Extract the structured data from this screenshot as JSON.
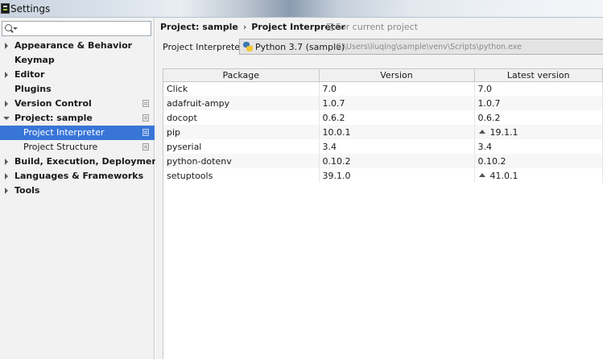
{
  "window": {
    "title": "Settings"
  },
  "search": {
    "value": "",
    "placeholder": ""
  },
  "sidebar": {
    "items": [
      {
        "label": "Appearance & Behavior",
        "expandable": true,
        "expanded": false,
        "bold": true,
        "has_project_icon": false
      },
      {
        "label": "Keymap",
        "expandable": false,
        "bold": true,
        "has_project_icon": false
      },
      {
        "label": "Editor",
        "expandable": true,
        "expanded": false,
        "bold": true,
        "has_project_icon": false
      },
      {
        "label": "Plugins",
        "expandable": false,
        "bold": true,
        "has_project_icon": false
      },
      {
        "label": "Version Control",
        "expandable": true,
        "expanded": false,
        "bold": true,
        "has_project_icon": true
      },
      {
        "label": "Project: sample",
        "expandable": true,
        "expanded": true,
        "bold": true,
        "has_project_icon": true
      },
      {
        "label": "Project Interpreter",
        "child": true,
        "selected": true,
        "has_project_icon": true
      },
      {
        "label": "Project Structure",
        "child": true,
        "selected": false,
        "has_project_icon": true
      },
      {
        "label": "Build, Execution, Deployment",
        "expandable": true,
        "expanded": false,
        "bold": true,
        "has_project_icon": false
      },
      {
        "label": "Languages & Frameworks",
        "expandable": true,
        "expanded": false,
        "bold": true,
        "has_project_icon": false
      },
      {
        "label": "Tools",
        "expandable": true,
        "expanded": false,
        "bold": true,
        "has_project_icon": false
      }
    ]
  },
  "breadcrumb": {
    "parent": "Project: sample",
    "separator": "›",
    "current": "Project Interpreter"
  },
  "for_current_project": "For current project",
  "interpreter": {
    "label": "Project Interpreter:",
    "name": "Python 3.7 (sample)",
    "path": "C:\\Users\\liuqing\\sample\\venv\\Scripts\\python.exe"
  },
  "table": {
    "headers": [
      "Package",
      "Version",
      "Latest version"
    ],
    "rows": [
      {
        "package": "Click",
        "version": "7.0",
        "latest": "7.0",
        "upgrade": false
      },
      {
        "package": "adafruit-ampy",
        "version": "1.0.7",
        "latest": "1.0.7",
        "upgrade": false
      },
      {
        "package": "docopt",
        "version": "0.6.2",
        "latest": "0.6.2",
        "upgrade": false
      },
      {
        "package": "pip",
        "version": "10.0.1",
        "latest": "19.1.1",
        "upgrade": true
      },
      {
        "package": "pyserial",
        "version": "3.4",
        "latest": "3.4",
        "upgrade": false
      },
      {
        "package": "python-dotenv",
        "version": "0.10.2",
        "latest": "0.10.2",
        "upgrade": false
      },
      {
        "package": "setuptools",
        "version": "39.1.0",
        "latest": "41.0.1",
        "upgrade": true
      }
    ]
  },
  "colors": {
    "selection": "#3875d7",
    "panel": "#f2f2f2"
  },
  "icons": [
    "search-icon",
    "python-icon",
    "project-scope-icon",
    "upgrade-arrow-icon"
  ]
}
